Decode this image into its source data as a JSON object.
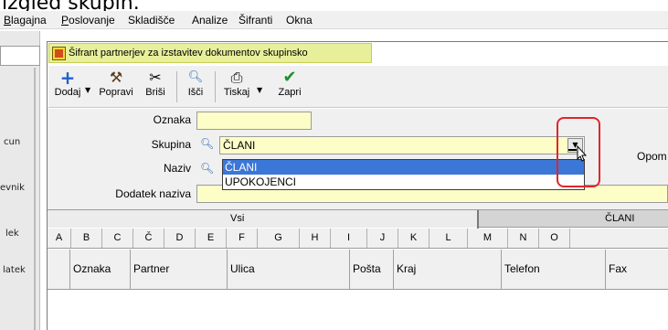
{
  "caption": "izgled skupin.",
  "menubar": {
    "items": [
      {
        "label": "Blagajna",
        "underline": "B",
        "rest": "lagajna"
      },
      {
        "label": "Poslovanje",
        "underline": "P",
        "rest": "oslovanje"
      },
      {
        "label": "Skladišče",
        "underline": "",
        "rest": "Skladišče"
      },
      {
        "label": "Analize",
        "underline": "",
        "rest": "Analize"
      },
      {
        "label": "Šifranti",
        "underline": "",
        "rest": "Šifranti"
      },
      {
        "label": "Okna",
        "underline": "",
        "rest": "Okna"
      }
    ]
  },
  "left_panel": {
    "items": [
      "cun",
      "evnik",
      "lek",
      "latek"
    ]
  },
  "window": {
    "title": "Šifrant partnerjev za izstavitev dokumentov skupinsko"
  },
  "toolbar": {
    "add_label": "Dodaj",
    "fix_label": "Popravi",
    "delete_label": "Briši",
    "search_label": "Išči",
    "print_label": "Tiskaj",
    "close_label": "Zapri",
    "icons": {
      "add": "plus-icon",
      "fix": "hammer-icon",
      "delete": "scissors-icon",
      "search": "search-icon",
      "print": "printer-icon",
      "close": "checkmark-icon"
    }
  },
  "form": {
    "oznaka_label": "Oznaka",
    "oznaka_value": "",
    "skupina_label": "Skupina",
    "skupina_value": "ČLANI",
    "naziv_label": "Naziv",
    "naziv_value": "",
    "dodatek_label": "Dodatek naziva",
    "dodatek_value": "",
    "opomba_label": "Opom"
  },
  "dropdown": {
    "options": [
      "ČLANI",
      "UPOKOJENCI"
    ],
    "selected": "ČLANI"
  },
  "tabs": {
    "items": [
      "Vsi",
      "ČLANI"
    ],
    "active": "Vsi"
  },
  "letters": [
    "A",
    "B",
    "C",
    "Č",
    "D",
    "E",
    "F",
    "G",
    "H",
    "I",
    "J",
    "K",
    "L",
    "M",
    "N",
    "O"
  ],
  "grid": {
    "columns": [
      "Oznaka",
      "Partner",
      "Ulica",
      "Pošta",
      "Kraj",
      "Telefon",
      "Fax"
    ]
  },
  "colors": {
    "title_bg": "#e8ef9a",
    "field_bg": "#fdfdc8",
    "selection": "#3b77d6",
    "highlight": "#e0262a",
    "add_icon": "#1f5fd0",
    "close_icon": "#1e8f2e"
  }
}
